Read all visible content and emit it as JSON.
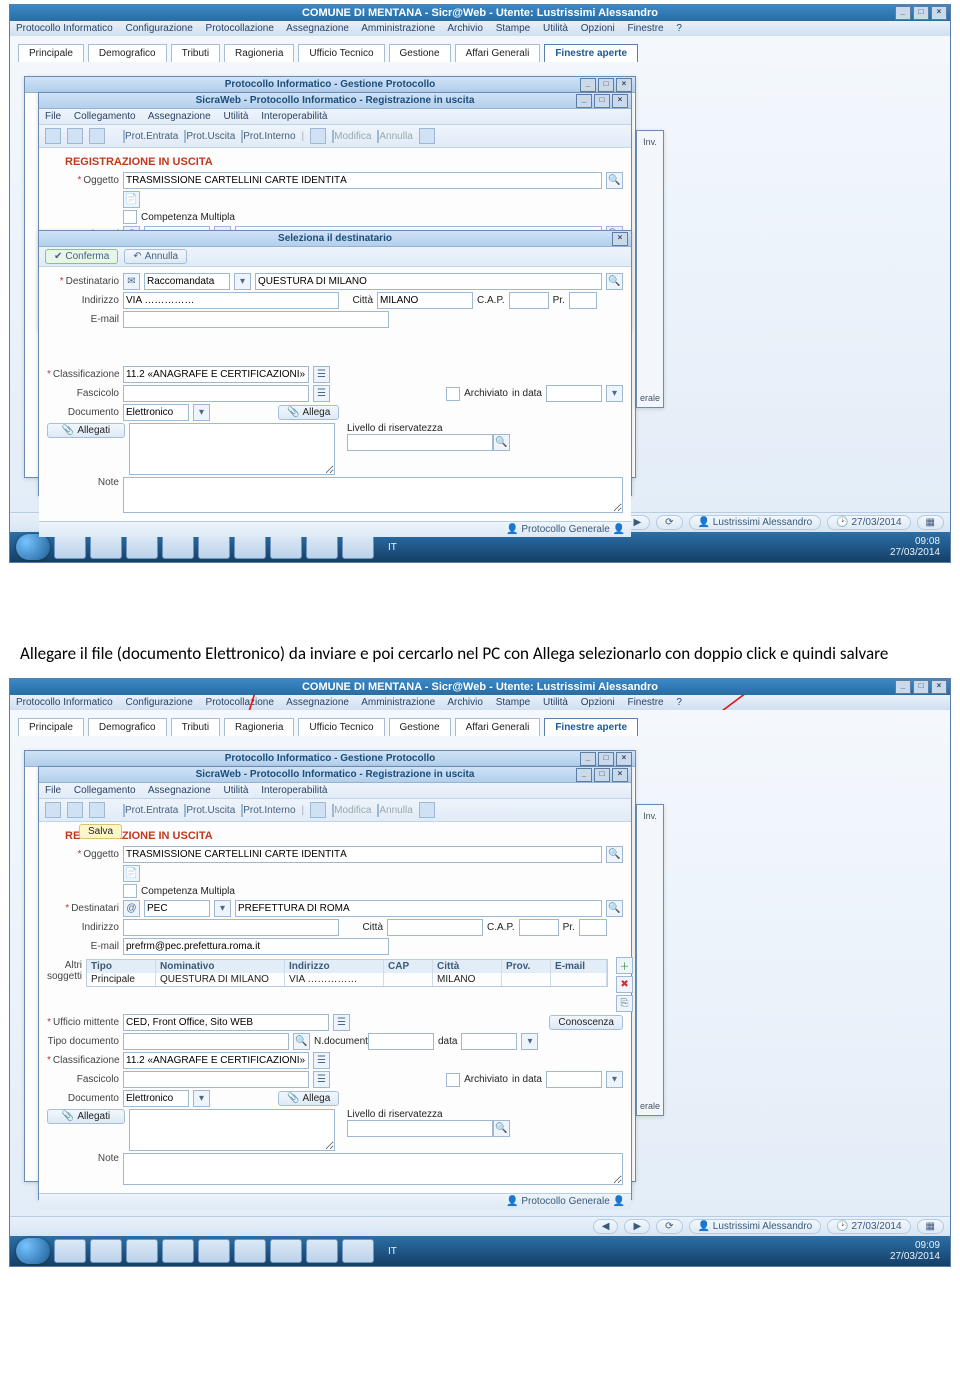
{
  "main_title": "COMUNE DI MENTANA  -  Sicr@Web  -  Utente: Lustrissimi Alessandro",
  "menubar": [
    "Protocollo Informatico",
    "Configurazione",
    "Protocollazione",
    "Assegnazione",
    "Amministrazione",
    "Archivio",
    "Stampe",
    "Utilità",
    "Opzioni",
    "Finestre",
    "?"
  ],
  "tabs": [
    "Principale",
    "Demografico",
    "Tributi",
    "Ragioneria",
    "Ufficio Tecnico",
    "Gestione",
    "Affari Generali",
    "Finestre aperte"
  ],
  "active_tab": "Finestre aperte",
  "win1": {
    "title": "Protocollo Informatico - Gestione Protocollo",
    "subtitle": "SicraWeb - Protocollo Informatico - Registrazione in uscita",
    "submenu": [
      "File",
      "Collegamento",
      "Assegnazione",
      "Utilità",
      "Interoperabilità"
    ],
    "toolbar_labels": {
      "entrata": "Prot.Entrata",
      "uscita": "Prot.Uscita",
      "interno": "Prot.Interno",
      "modifica": "Modifica",
      "annulla": "Annulla"
    },
    "section": "REGISTRAZIONE IN USCITA",
    "oggetto_label": "Oggetto",
    "oggetto": "TRASMISSIONE CARTELLINI CARTE IDENTITÀ",
    "competenza": "Competenza Multipla",
    "destinatari_label": "Destinatari",
    "destinatari_type": "PEC",
    "destinatari_val": "PREFETTURA DI ROMA",
    "indirizzo_label": "Indirizzo",
    "citta_label": "Città",
    "cap_label": "C.A.P.",
    "pr_label": "Pr.",
    "dialog": {
      "title": "Seleziona il destinatario",
      "conferma": "Conferma",
      "annulla": "Annulla",
      "destinatario_label": "Destinatario",
      "dest_type": "Raccomandata",
      "dest_val": "QUESTURA DI MILANO",
      "indirizzo_label": "Indirizzo",
      "indirizzo_val": "VIA ……………",
      "citta_label": "Città",
      "citta_val": "MILANO",
      "cap_label": "C.A.P.",
      "pr_label": "Pr.",
      "email_label": "E-mail"
    },
    "classificazione_label": "Classificazione",
    "classificazione": "11.2 «ANAGRAFE E CERTIFICAZIONI»",
    "fascicolo_label": "Fascicolo",
    "archiviato": "Archiviato",
    "in_data": "in data",
    "documento_label": "Documento",
    "documento_val": "Elettronico",
    "allega_btn": "Allega",
    "allegati_btn": "Allegati",
    "riservatezza": "Livello di riservatezza",
    "note_label": "Note",
    "footer": "Protocollo Generale"
  },
  "inv_label": "Inv.",
  "erale_label": "erale",
  "status": {
    "user": "Lustrissimi Alessandro",
    "date": "27/03/2014"
  },
  "taskbar": {
    "lang": "IT",
    "time": "09:08",
    "date": "27/03/2014"
  },
  "caption": "Allegare il file (documento Elettronico) da inviare e poi cercarlo nel PC con Allega selezionarlo con doppio click e quindi salvare",
  "win2": {
    "salva": "Salva",
    "email": "prefrm@pec.prefettura.roma.it",
    "email_label": "E-mail",
    "altri_label": "Altri soggetti",
    "altri_headers": [
      "Tipo",
      "Nominativo",
      "Indirizzo",
      "CAP",
      "Città",
      "Prov.",
      "E-mail"
    ],
    "altri_row": {
      "tipo": "Principale",
      "nominativo": "QUESTURA DI MILANO",
      "indirizzo": "VIA ……………",
      "cap": "",
      "citta": "MILANO",
      "prov": "",
      "email": ""
    },
    "ufficio_label": "Ufficio mittente",
    "ufficio": "CED, Front Office, Sito WEB",
    "conoscenza": "Conoscenza",
    "tipodoc_label": "Tipo documento",
    "ndoc_label": "N.documento",
    "data_label": "data"
  },
  "taskbar2": {
    "time": "09:09",
    "date": "27/03/2014"
  }
}
